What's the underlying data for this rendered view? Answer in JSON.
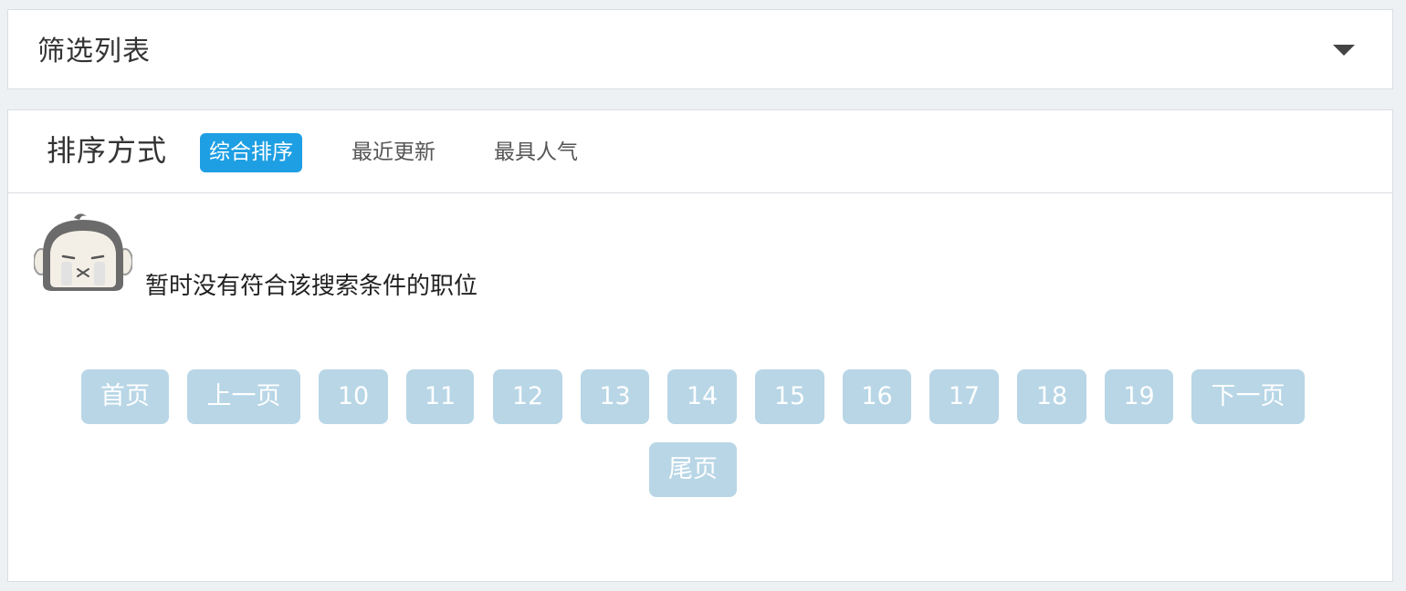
{
  "filter": {
    "title": "筛选列表",
    "toggle_icon": "caret-down-icon"
  },
  "sort": {
    "label": "排序方式",
    "options": [
      {
        "label": "综合排序",
        "active": true
      },
      {
        "label": "最近更新",
        "active": false
      },
      {
        "label": "最具人气",
        "active": false
      }
    ]
  },
  "empty": {
    "icon": "crying-face-icon",
    "message": "暂时没有符合该搜索条件的职位"
  },
  "pagination": {
    "first": "首页",
    "prev": "上一页",
    "pages": [
      "10",
      "11",
      "12",
      "13",
      "14",
      "15",
      "16",
      "17",
      "18",
      "19"
    ],
    "next": "下一页",
    "last": "尾页"
  },
  "colors": {
    "accent": "#1e9fe3",
    "pager_bg": "#b8d6e6",
    "page_bg": "#eef1f4"
  }
}
